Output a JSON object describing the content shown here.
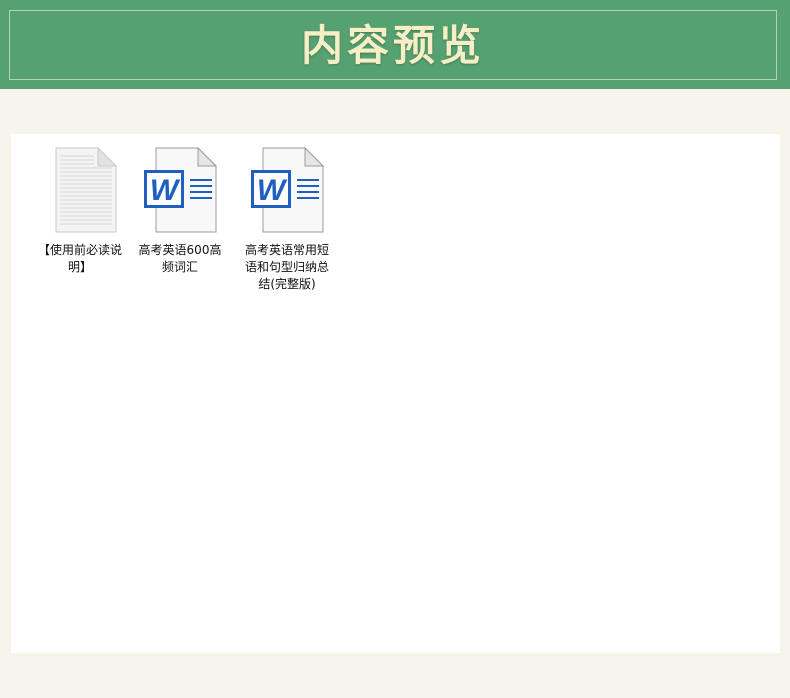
{
  "header": {
    "title": "内容预览"
  },
  "files": [
    {
      "name": "【使用前必读说明】",
      "icon": "text-document-icon"
    },
    {
      "name": "高考英语600高频词汇",
      "icon": "word-document-icon"
    },
    {
      "name": "高考英语常用短语和句型归纳总结(完整版)",
      "icon": "word-document-icon"
    }
  ],
  "colors": {
    "header_bg": "#56a172",
    "title": "#f6eec4",
    "page_bg": "#f7f4ec",
    "word_blue": "#1f5fbf"
  }
}
